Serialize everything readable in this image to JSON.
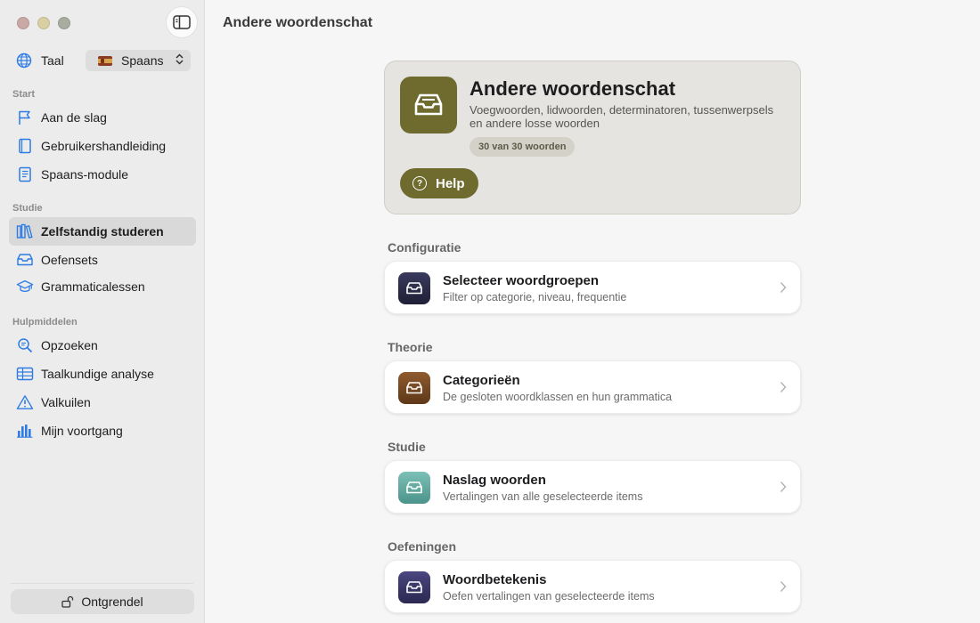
{
  "sidebar": {
    "language_label": "Taal",
    "language_value": "Spaans",
    "sections": {
      "start": "Start",
      "study": "Studie",
      "tools": "Hulpmiddelen"
    },
    "items": [
      {
        "label": "Aan de slag",
        "icon": "flag-icon"
      },
      {
        "label": "Gebruikershandleiding",
        "icon": "book-icon"
      },
      {
        "label": "Spaans-module",
        "icon": "module-book-icon"
      },
      {
        "label": "Zelfstandig studeren",
        "icon": "books-icon",
        "active": true
      },
      {
        "label": "Oefensets",
        "icon": "tray-icon"
      },
      {
        "label": "Grammaticalessen",
        "icon": "graduation-cap-icon"
      },
      {
        "label": "Opzoeken",
        "icon": "magnifier-icon"
      },
      {
        "label": "Taalkundige analyse",
        "icon": "table-icon"
      },
      {
        "label": "Valkuilen",
        "icon": "warning-icon"
      },
      {
        "label": "Mijn voortgang",
        "icon": "bar-chart-icon"
      }
    ],
    "unlock_label": "Ontgrendel"
  },
  "main": {
    "page_title": "Andere woordenschat",
    "hero": {
      "title": "Andere woordenschat",
      "description": "Voegwoorden, lidwoorden, determinatoren, tussenwerpsels en andere losse woorden",
      "badge": "30 van 30 woorden",
      "help_label": "Help"
    },
    "groups": [
      {
        "heading": "Configuratie",
        "title": "Selecteer woordgroepen",
        "subtitle": "Filter op categorie, niveau, frequentie",
        "color": "#2b2b4a"
      },
      {
        "heading": "Theorie",
        "title": "Categorieën",
        "subtitle": "De gesloten woordklassen en hun grammatica",
        "color": "#7a4a24"
      },
      {
        "heading": "Studie",
        "title": "Naslag woorden",
        "subtitle": "Vertalingen van alle geselecteerde items",
        "color": "#5aa39a"
      },
      {
        "heading": "Oefeningen",
        "title": "Woordbetekenis",
        "subtitle": "Oefen vertalingen van geselecteerde items",
        "color": "#33305a"
      }
    ]
  },
  "colors": {
    "accent": "#6f6b2f",
    "sidebar_icon": "#2d7be5"
  }
}
